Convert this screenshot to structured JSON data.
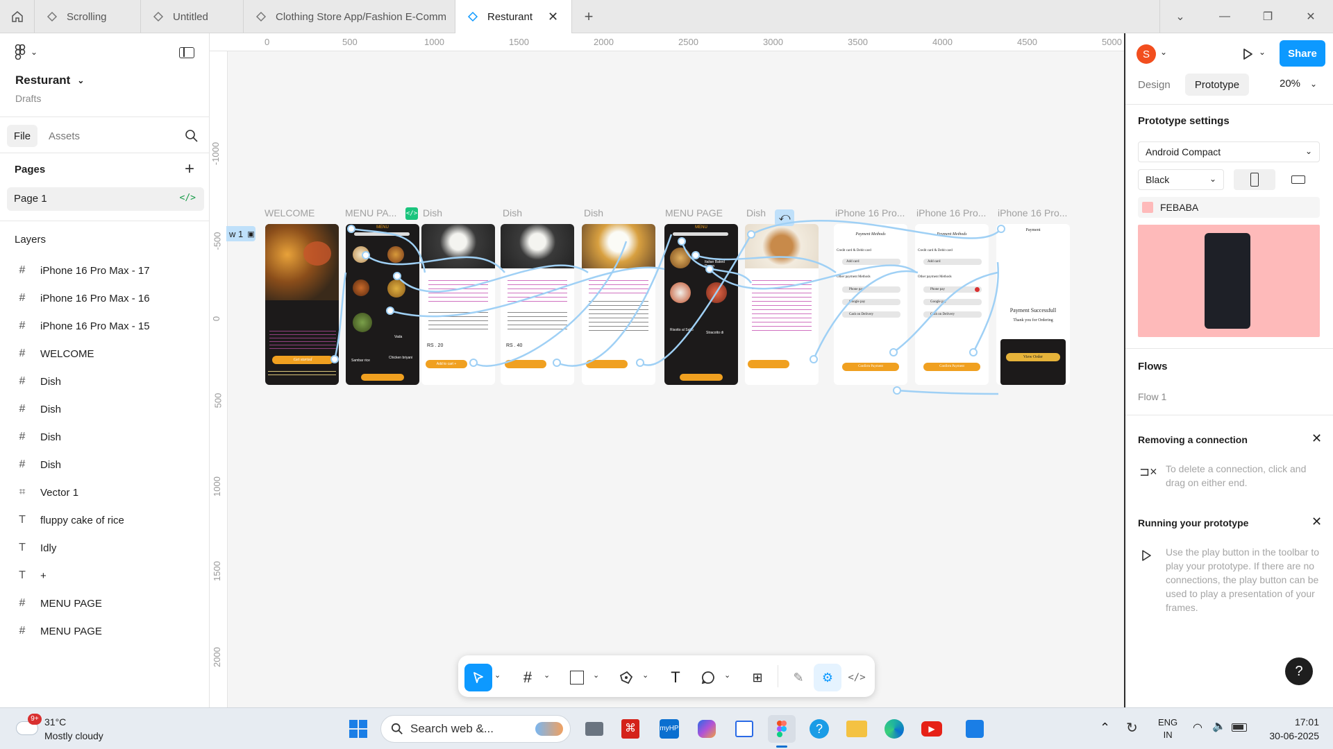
{
  "tabs": [
    {
      "label": "Scrolling"
    },
    {
      "label": "Untitled"
    },
    {
      "label": "Clothing Store App/Fashion E-Comm"
    },
    {
      "label": "Resturant"
    }
  ],
  "file": {
    "name": "Resturant",
    "location": "Drafts"
  },
  "left_tabs": {
    "file": "File",
    "assets": "Assets"
  },
  "pages": {
    "heading": "Pages",
    "items": [
      "Page 1"
    ]
  },
  "layers": {
    "heading": "Layers",
    "items": [
      {
        "type": "frame",
        "label": "iPhone 16 Pro Max - 17"
      },
      {
        "type": "frame",
        "label": "iPhone 16 Pro Max - 16"
      },
      {
        "type": "frame",
        "label": "iPhone 16 Pro Max - 15"
      },
      {
        "type": "frame",
        "label": "WELCOME"
      },
      {
        "type": "frame",
        "label": "Dish"
      },
      {
        "type": "frame",
        "label": "Dish"
      },
      {
        "type": "frame",
        "label": "Dish"
      },
      {
        "type": "frame",
        "label": "Dish"
      },
      {
        "type": "vector",
        "label": "Vector 1"
      },
      {
        "type": "text",
        "label": "fluppy cake of rice"
      },
      {
        "type": "text",
        "label": "Idly"
      },
      {
        "type": "text",
        "label": "+"
      },
      {
        "type": "frame",
        "label": "MENU PAGE"
      },
      {
        "type": "frame",
        "label": "MENU PAGE"
      }
    ]
  },
  "ruler": {
    "top": [
      "0",
      "500",
      "1000",
      "1500",
      "2000",
      "2500",
      "3000",
      "3500",
      "4000",
      "4500",
      "5000"
    ],
    "left": [
      "-1000",
      "-500",
      "0",
      "500",
      "1000",
      "1500",
      "2000"
    ]
  },
  "canvas": {
    "flow_tag": "w 1",
    "frames": [
      {
        "label": "WELCOME",
        "theme": "dark"
      },
      {
        "label": "MENU PA...",
        "theme": "dark"
      },
      {
        "label": "Dish",
        "theme": "light"
      },
      {
        "label": "Dish",
        "theme": "light"
      },
      {
        "label": "Dish",
        "theme": "light"
      },
      {
        "label": "MENU PAGE",
        "theme": "dark"
      },
      {
        "label": "Dish",
        "theme": "light"
      },
      {
        "label": "iPhone 16 Pro...",
        "theme": "light"
      },
      {
        "label": "iPhone 16 Pro...",
        "theme": "light"
      },
      {
        "label": "iPhone 16 Pro...",
        "theme": "light"
      }
    ],
    "screen_text": {
      "menu": "MENU",
      "payment_methods": "Payment Methods",
      "credit_card": "Credit card & Debit card",
      "add_card": "Add card",
      "other_methods": "Other payment Methods",
      "phone_pay": "Phone pay",
      "google_pay": "Google pay",
      "cash": "Cash on Delivery",
      "confirm": "Confirm Payment",
      "payment": "Payment",
      "success": "Payment Successfull",
      "thanks": "Thank you for Ordering",
      "view_order": "View Order",
      "add_to_cart": "Add to cart +",
      "price_1": "RS . 20",
      "price_2": "RS . 40",
      "get_started": "Get started",
      "italian_baked": "Italian Baked Prawn",
      "sambar_rice": "Sambar rice",
      "chicken_briyani": "Chicken briyani",
      "vada": "Vada",
      "risotto": "Risotto al Salto",
      "stracotto": "Stracotto di"
    }
  },
  "right": {
    "avatar_letter": "S",
    "share": "Share",
    "tab_design": "Design",
    "tab_prototype": "Prototype",
    "zoom": "20%",
    "settings_heading": "Prototype settings",
    "device": "Android Compact",
    "color_model": "Black",
    "bg_hex": "FEBABA",
    "bg_color": "#FEBABA",
    "flows_heading": "Flows",
    "flow_item": "Flow 1",
    "remove_heading": "Removing a connection",
    "remove_text": "To delete a connection, click and drag on either end.",
    "running_heading": "Running your prototype",
    "running_text": "Use the play button in the toolbar to play your prototype. If there are no connections, the play button can be used to play a presentation of your frames."
  },
  "help": "?",
  "taskbar": {
    "weather_badge": "9+",
    "temperature": "31°C",
    "weather": "Mostly cloudy",
    "search_placeholder": "Search web &...",
    "lang_1": "ENG",
    "lang_2": "IN",
    "time": "17:01",
    "date": "30-06-2025"
  },
  "colors": {
    "accent": "#0d99ff",
    "flow_line": "#9fd0f5",
    "orange": "#f0a020"
  }
}
